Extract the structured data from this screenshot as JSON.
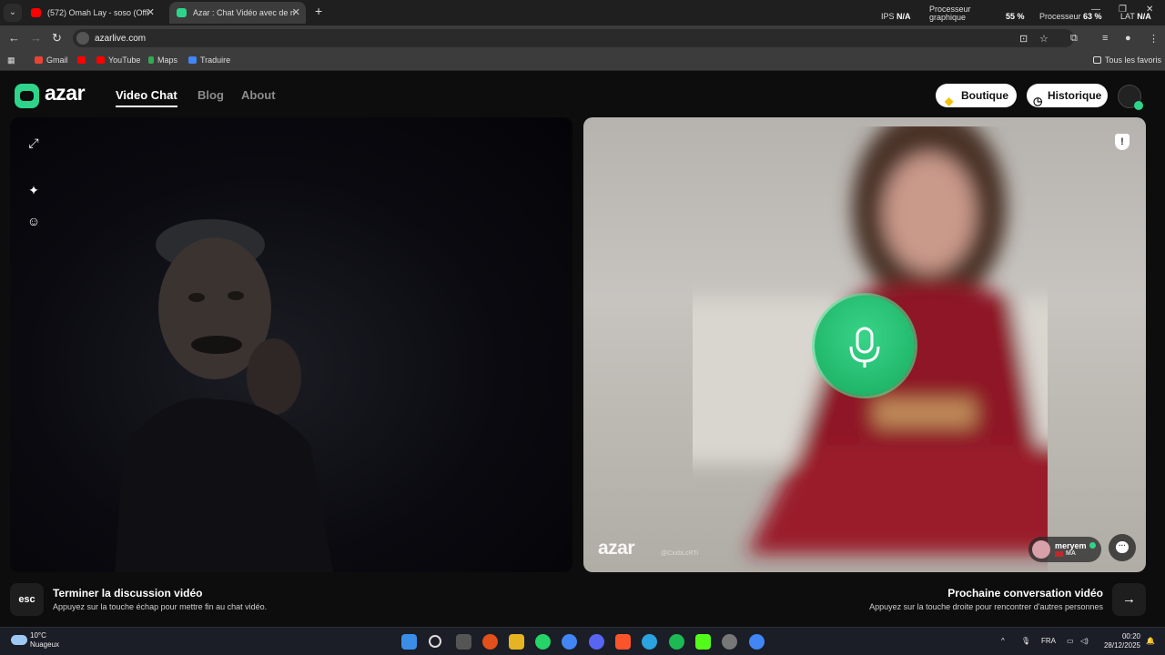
{
  "browser": {
    "tabs": [
      {
        "title": "(572) Omah Lay - soso (Offi",
        "favicon_color": "#ff0000"
      },
      {
        "title": "Azar : Chat Vidéo avec de n",
        "favicon_color": "#2ed48a"
      }
    ],
    "perf": {
      "ips_label": "IPS",
      "ips_value": "N/A",
      "gpu_label_1": "Processeur",
      "gpu_label_2": "graphique",
      "gpu_value": "55 %",
      "cpu_label": "Processeur",
      "cpu_value": "63 %",
      "lat_label": "LAT",
      "lat_value": "N/A"
    },
    "url": "azarlive.com",
    "bookmarks": [
      "Gmail",
      "YouTube",
      "Maps",
      "Traduire"
    ],
    "all_bookmarks": "Tous les favoris"
  },
  "site": {
    "logo": "azar",
    "nav": [
      "Video Chat",
      "Blog",
      "About"
    ],
    "shop_label": "Boutique",
    "history_label": "Historique"
  },
  "remote": {
    "watermark": "azar",
    "watermark_code": "@CxxbLcRTi",
    "user_name": "meryem",
    "user_country": "MA"
  },
  "bottom": {
    "esc_label": "esc",
    "end_title": "Terminer la discussion vidéo",
    "end_sub": "Appuyez sur la touche échap pour mettre fin au chat vidéo.",
    "next_title": "Prochaine conversation vidéo",
    "next_sub": "Appuyez sur la touche droite pour rencontrer d'autres personnes"
  },
  "taskbar": {
    "temp": "10°C",
    "weather": "Nuageux",
    "lang": "FRA",
    "time": "00:20",
    "date": "28/12/2025"
  },
  "colors": {
    "accent": "#2ed48a"
  }
}
